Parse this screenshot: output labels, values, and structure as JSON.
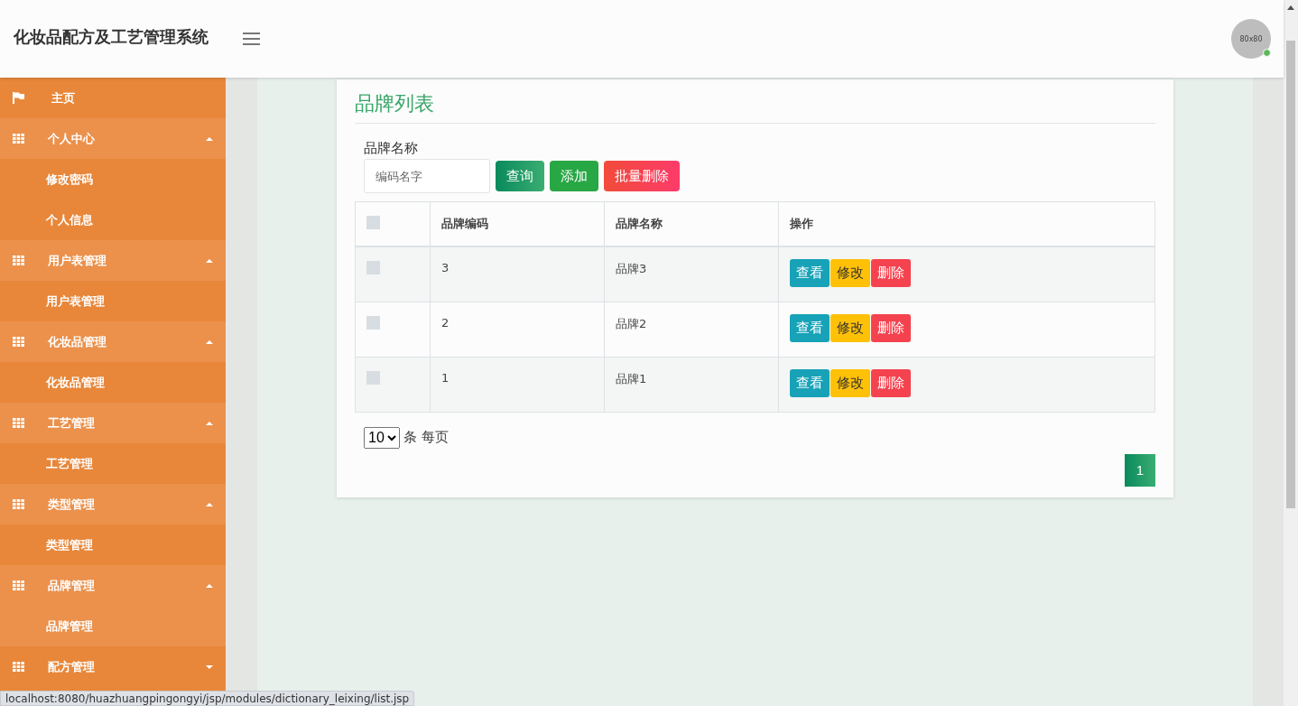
{
  "header": {
    "title": "化妆品配方及工艺管理系统",
    "avatar_text": "80x80",
    "online": true
  },
  "sidebar": {
    "items": [
      {
        "kind": "link",
        "label": "主页"
      },
      {
        "kind": "group",
        "label": "个人中心",
        "expanded": true,
        "children": [
          {
            "label": "修改密码",
            "selected": false
          },
          {
            "label": "个人信息",
            "selected": false
          }
        ]
      },
      {
        "kind": "group",
        "label": "用户表管理",
        "expanded": true,
        "children": [
          {
            "label": "用户表管理",
            "selected": false
          }
        ]
      },
      {
        "kind": "group",
        "label": "化妆品管理",
        "expanded": true,
        "children": [
          {
            "label": "化妆品管理",
            "selected": false
          }
        ]
      },
      {
        "kind": "group",
        "label": "工艺管理",
        "expanded": true,
        "children": [
          {
            "label": "工艺管理",
            "selected": false
          }
        ]
      },
      {
        "kind": "group",
        "label": "类型管理",
        "expanded": true,
        "children": [
          {
            "label": "类型管理",
            "selected": false
          }
        ]
      },
      {
        "kind": "group",
        "label": "品牌管理",
        "expanded": true,
        "children": [
          {
            "label": "品牌管理",
            "selected": true
          }
        ]
      },
      {
        "kind": "group",
        "label": "配方管理",
        "expanded": false
      }
    ]
  },
  "panel": {
    "title": "品牌列表",
    "search": {
      "label": "品牌名称",
      "placeholder": "编码名字"
    },
    "buttons": [
      {
        "kind": "query",
        "label": "查询"
      },
      {
        "kind": "add",
        "label": "添加"
      },
      {
        "kind": "delete",
        "label": "批量删除"
      }
    ],
    "table": {
      "header_checked": false,
      "columns": [
        "品牌编码",
        "品牌名称",
        "操作"
      ],
      "rows": [
        {
          "checked": false,
          "cells": [
            "3",
            "品牌3"
          ],
          "actions": [
            {
              "kind": "view",
              "label": "查看"
            },
            {
              "kind": "edit",
              "label": "修改"
            },
            {
              "kind": "delete",
              "label": "删除"
            }
          ]
        },
        {
          "checked": false,
          "cells": [
            "2",
            "品牌2"
          ],
          "actions": [
            {
              "kind": "view",
              "label": "查看"
            },
            {
              "kind": "edit",
              "label": "修改"
            },
            {
              "kind": "delete",
              "label": "删除"
            }
          ]
        },
        {
          "checked": false,
          "cells": [
            "1",
            "品牌1"
          ],
          "actions": [
            {
              "kind": "view",
              "label": "查看"
            },
            {
              "kind": "edit",
              "label": "修改"
            },
            {
              "kind": "delete",
              "label": "删除"
            }
          ]
        }
      ]
    },
    "page_size": {
      "value": "10",
      "suffix": "条 每页"
    },
    "pages": [
      {
        "label": "1",
        "selected": true
      }
    ]
  },
  "status_url": "localhost:8080/huazhuangpingongyi/jsp/modules/dictionary_leixing/list.jsp"
}
